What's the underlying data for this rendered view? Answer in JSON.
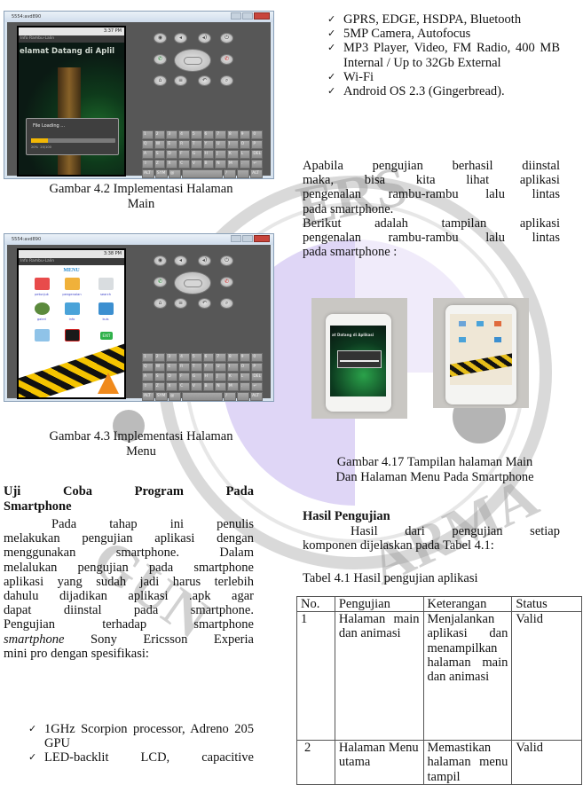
{
  "left_column": {
    "figure_4_2": {
      "window_title": "5554:avd890",
      "status_time": "3:37 PM",
      "app_title": "Info Rambu-Lalin",
      "welcome_text": "elamat Datang di Aplil",
      "dialog_title": "File Loading ...",
      "progress_percent": 20,
      "progress_label": "20%",
      "progress_count": "20/100",
      "caption_line1": "Gambar 4.2 Implementasi Halaman",
      "caption_line2": "Main"
    },
    "figure_4_3": {
      "window_title": "5554:avd890",
      "status_time": "3:38 PM",
      "app_title": "Info Rambu-Lalin",
      "menu_heading": "MENU",
      "menu_items": [
        "petunjuk",
        "pengenalan",
        "search",
        "galeri",
        "info",
        "kuis",
        "",
        "",
        "EXIT"
      ],
      "caption_line1": "Gambar 4.3 Implementasi Halaman",
      "caption_line2": "Menu"
    },
    "keyboard_rows": [
      [
        "1",
        "2",
        "3",
        "4",
        "5",
        "6",
        "7",
        "8",
        "9",
        "0"
      ],
      [
        "Q",
        "W",
        "E",
        "R",
        "T",
        "Y",
        "U",
        "I",
        "O",
        "P"
      ],
      [
        "A",
        "S",
        "D",
        "F",
        "G",
        "H",
        "J",
        "K",
        "L",
        "DEL"
      ],
      [
        "⇧",
        "Z",
        "X",
        "C",
        "V",
        "B",
        "N",
        "M",
        ".",
        "↵"
      ],
      [
        "ALT",
        "SYM",
        "@",
        "",
        "/",
        "",
        "ALT"
      ]
    ],
    "section_heading_line1": [
      "Uji",
      "Coba",
      "Program",
      "Pada"
    ],
    "section_heading_line2": "Smartphone",
    "paragraph_first_line": [
      "Pada",
      "tahap",
      "ini",
      "penulis"
    ],
    "paragraph_lines": [
      "melakukan pengujian aplikasi dengan",
      "menggunakan smartphone. Dalam",
      "melalukan pengujian pada smartphone",
      "aplikasi yang sudah jadi harus terlebih",
      "dahulu dijadikan aplikasi .apk agar",
      "dapat diinstal pada smartphone.",
      "Pengujian terhadap smartphone"
    ],
    "paragraph_italic_word": "smartphone",
    "paragraph_italic_rest": " Sony Ericsson Experia",
    "paragraph_last_line": "mini pro dengan spesifikasi:",
    "specs": [
      "1GHz Scorpion processor, Adreno 205 GPU",
      "LED-backlit LCD, capacitive"
    ]
  },
  "right_column": {
    "specs": [
      "GPRS, EDGE, HSDPA, Bluetooth",
      "5MP Camera, Autofocus",
      "MP3 Player, Video, FM Radio, 400 MB Internal / Up to 32Gb External",
      "Wi-Fi",
      "Android OS 2.3 (Gingerbread)."
    ],
    "paragraph1_lines": [
      "Apabila pengujian berhasil diinstal",
      "maka, bisa kita lihat aplikasi",
      "pengenalan rambu-rambu lalu lintas",
      "pada smartphone."
    ],
    "paragraph2_lines": [
      "Berikut adalah tampilan aplikasi",
      "pengenalan rambu-rambu lalu lintas",
      "pada smartphone :"
    ],
    "photo_left_screen_text": "at Datang di Aplikasi",
    "figure_4_17_caption_line1": "Gambar 4.17 Tampilan  halaman Main",
    "figure_4_17_caption_line2": "Dan Halaman Menu Pada Smartphone",
    "results_heading": "Hasil Pengujian",
    "results_paragraph_line1": "Hasil dari pengujian setiap",
    "results_paragraph_line2": "komponen dijelaskan pada Tabel 4.1:",
    "table_caption": "Tabel 4.1 Hasil pengujian aplikasi",
    "table": {
      "headers": [
        "No.",
        "Pengujian",
        "Keterangan",
        "Status"
      ],
      "rows": [
        {
          "no": "1",
          "pengujian": "Halaman main dan animasi",
          "keterangan": "Menjalankan aplikasi dan menampilkan halaman main dan animasi",
          "status": "Valid"
        },
        {
          "no": "2",
          "pengujian": "Halaman Menu utama",
          "keterangan": "Memastikan halaman menu tampil",
          "status": "Valid"
        }
      ]
    }
  },
  "colors": {
    "progress_fill": "#f2b705",
    "menu_heading": "#2c8ccf",
    "watermark_purple": "#9b7fd6",
    "watermark_gray": "#8a8a8a"
  }
}
